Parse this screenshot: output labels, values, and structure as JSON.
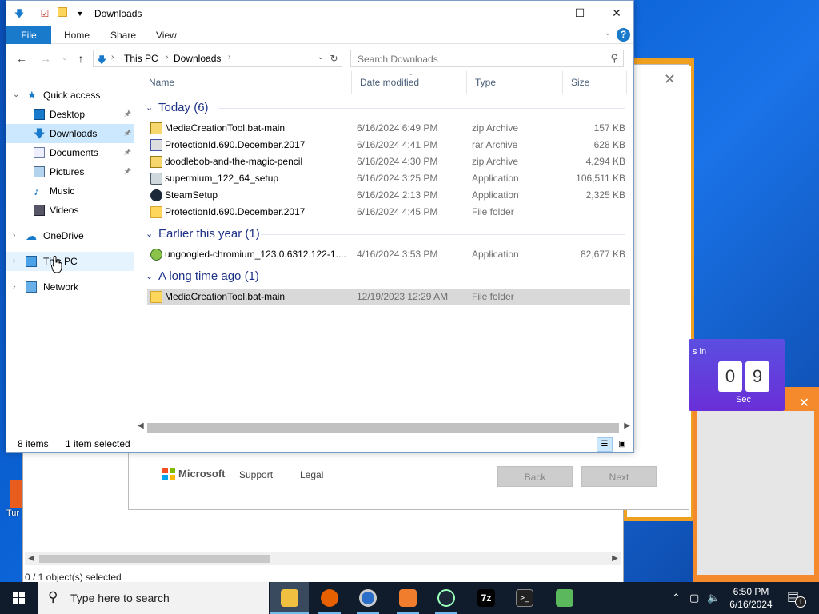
{
  "explorer": {
    "title": "Downloads",
    "ribbon_tabs": [
      "File",
      "Home",
      "Share",
      "View"
    ],
    "help_label": "?",
    "address": {
      "parts": [
        "This PC",
        "Downloads"
      ]
    },
    "search_placeholder": "Search Downloads",
    "nav": [
      {
        "label": "Quick access",
        "icon": "star-icon",
        "chevron": "⌄"
      },
      {
        "label": "Desktop",
        "icon": "desktop-icon",
        "pinned": true
      },
      {
        "label": "Downloads",
        "icon": "download-icon",
        "pinned": true,
        "selected": true
      },
      {
        "label": "Documents",
        "icon": "documents-icon",
        "pinned": true
      },
      {
        "label": "Pictures",
        "icon": "pictures-icon",
        "pinned": true
      },
      {
        "label": "Music",
        "icon": "music-icon"
      },
      {
        "label": "Videos",
        "icon": "videos-icon"
      },
      {
        "label": "OneDrive",
        "icon": "cloud-icon",
        "chevron": "›"
      },
      {
        "label": "This PC",
        "icon": "computer-icon",
        "chevron": "›",
        "hover": true
      },
      {
        "label": "Network",
        "icon": "network-icon",
        "chevron": "›"
      }
    ],
    "columns": [
      "Name",
      "Date modified",
      "Type",
      "Size"
    ],
    "groups": [
      {
        "title": "Today (6)",
        "rows": [
          {
            "name": "MediaCreationTool.bat-main",
            "date": "6/16/2024 6:49 PM",
            "type": "zip Archive",
            "size": "157 KB",
            "icon": "zip-icon"
          },
          {
            "name": "ProtectionId.690.December.2017",
            "date": "6/16/2024 4:41 PM",
            "type": "rar Archive",
            "size": "628 KB",
            "icon": "rar-icon"
          },
          {
            "name": "doodlebob-and-the-magic-pencil",
            "date": "6/16/2024 4:30 PM",
            "type": "zip Archive",
            "size": "4,294 KB",
            "icon": "zip-icon"
          },
          {
            "name": "supermium_122_64_setup",
            "date": "6/16/2024 3:25 PM",
            "type": "Application",
            "size": "106,511 KB",
            "icon": "installer-icon"
          },
          {
            "name": "SteamSetup",
            "date": "6/16/2024 2:13 PM",
            "type": "Application",
            "size": "2,325 KB",
            "icon": "steam-icon"
          },
          {
            "name": "ProtectionId.690.December.2017",
            "date": "6/16/2024 4:45 PM",
            "type": "File folder",
            "size": "",
            "icon": "folder-icon"
          }
        ]
      },
      {
        "title": "Earlier this year (1)",
        "rows": [
          {
            "name": "ungoogled-chromium_123.0.6312.122-1....",
            "date": "4/16/2024 3:53 PM",
            "type": "Application",
            "size": "82,677 KB",
            "icon": "chromium-icon"
          }
        ]
      },
      {
        "title": "A long time ago (1)",
        "rows": [
          {
            "name": "MediaCreationTool.bat-main",
            "date": "12/19/2023 12:29 AM",
            "type": "File folder",
            "size": "",
            "icon": "folder-icon",
            "selected": true
          }
        ]
      }
    ],
    "status": {
      "items": "8 items",
      "selected": "1 item selected"
    }
  },
  "setup_dialog": {
    "brand": "Microsoft",
    "links": [
      "Support",
      "Legal"
    ],
    "back_label": "Back",
    "next_label": "Next"
  },
  "timer": {
    "label": "s in",
    "digits": [
      "0",
      "9"
    ],
    "unit": "Sec"
  },
  "bg_window": {
    "status": "0 / 1 object(s) selected"
  },
  "desktop_icon": {
    "label": "Tur"
  },
  "taskbar": {
    "search_text": "Type here to search",
    "apps": [
      "file-explorer-icon",
      "firefox-icon",
      "chrome-icon",
      "app-icon",
      "steam-icon",
      "7zip-icon",
      "terminal-icon",
      "notepad-icon"
    ],
    "app_glyphs": {
      "7zip": "7z",
      "terminal": ">_"
    },
    "clock_time": "6:50 PM",
    "clock_date": "6/16/2024",
    "notification_count": "1"
  },
  "colors": {
    "accent": "#1979ca",
    "selection": "#cce8ff",
    "group_header": "#1e3287"
  }
}
